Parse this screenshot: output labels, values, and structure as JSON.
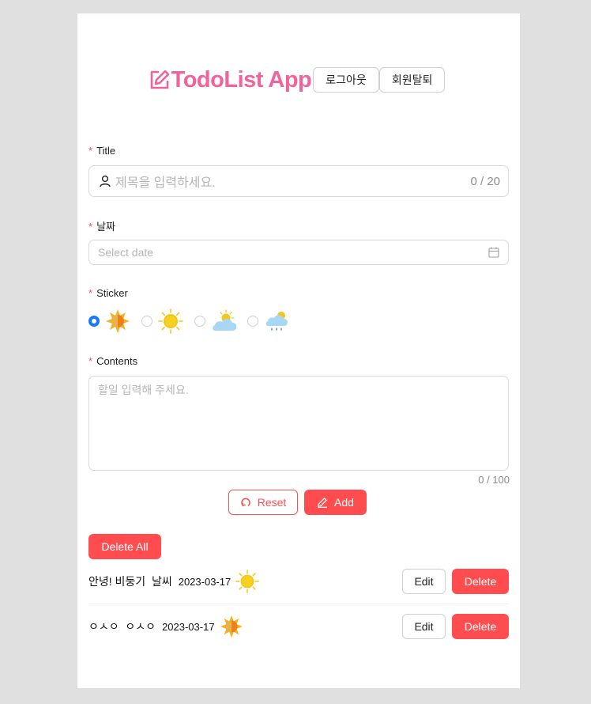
{
  "header": {
    "title": "TodoList App",
    "logout_label": "로그아웃",
    "withdraw_label": "회원탈퇴",
    "logo_icon": "edit-square-icon",
    "title_color": "#f0649e"
  },
  "form": {
    "title_label": "Title",
    "title_placeholder": "제목을 입력하세요.",
    "title_counter": "0 / 20",
    "date_label": "날짜",
    "date_placeholder": "Select date",
    "sticker_label": "Sticker",
    "stickers": [
      "sunny-face-icon",
      "sun-icon",
      "partly-cloudy-icon",
      "rain-cloud-icon"
    ],
    "selected_sticker": 0,
    "contents_label": "Contents",
    "contents_placeholder": "할일 입력해 주세요.",
    "contents_counter": "0 / 100",
    "reset_label": "Reset",
    "add_label": "Add"
  },
  "list": {
    "delete_all_label": "Delete All",
    "items": [
      {
        "text": "안녕! 비둥기  날씨",
        "date": "2023-03-17",
        "sticker": "sun-icon",
        "edit_label": "Edit",
        "delete_label": "Delete"
      },
      {
        "text": "ㅇㅅㅇ  ㅇㅅㅇ",
        "date": "2023-03-17",
        "sticker": "sunny-face-icon",
        "edit_label": "Edit",
        "delete_label": "Delete"
      }
    ]
  },
  "colors": {
    "danger": "#ff4d4f",
    "primary": "#1677ff",
    "background": "#e0e0e0"
  }
}
